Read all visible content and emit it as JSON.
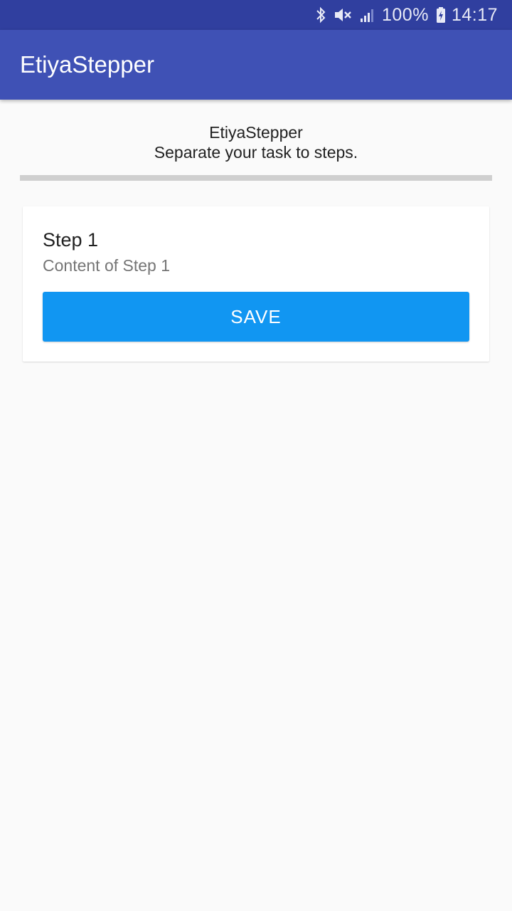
{
  "status_bar": {
    "battery_percent": "100%",
    "time": "14:17",
    "icons": [
      "bluetooth-icon",
      "muted-icon",
      "signal-icon",
      "battery-charging-icon"
    ]
  },
  "app_bar": {
    "title": "EtiyaStepper"
  },
  "header": {
    "title": "EtiyaStepper",
    "subtitle": "Separate your task to steps."
  },
  "progress": {
    "value": 0
  },
  "step": {
    "title": "Step 1",
    "content": "Content of Step 1",
    "save_label": "SAVE"
  },
  "colors": {
    "status_bar": "#303f9f",
    "app_bar": "#3f51b5",
    "button": "#1196f2",
    "progress_track": "#cfcfcf",
    "background": "#fafafa"
  }
}
